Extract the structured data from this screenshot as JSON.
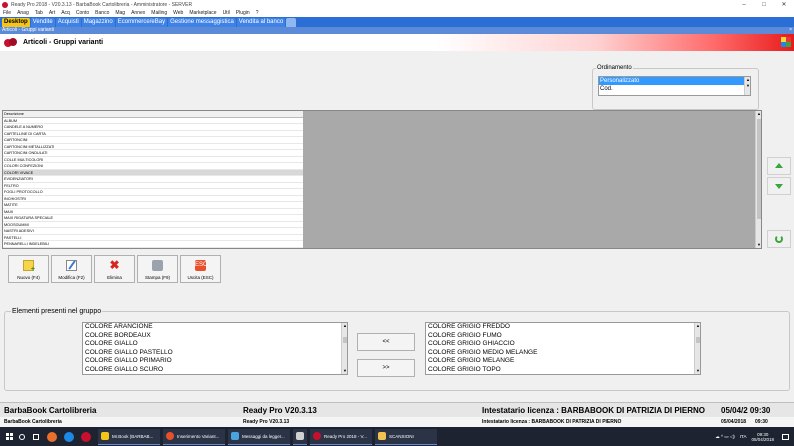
{
  "window": {
    "title": "Ready Pro 2018 - V20.3.13 - BarbaBook Cartolibreria - Amministratore - SERVER",
    "controls": {
      "minimize": "–",
      "maximize": "□",
      "close": "✕"
    }
  },
  "menu": [
    "File",
    "Anag",
    "Tab",
    "Art",
    "Acq",
    "Conto",
    "Banco",
    "Mag",
    "Annex",
    "Mailing",
    "Web",
    "Marketplace",
    "Util",
    "Plugin",
    "?"
  ],
  "tabs": [
    {
      "label": "Desktop",
      "active": true
    },
    {
      "label": "Vendite"
    },
    {
      "label": "Acquisti"
    },
    {
      "label": "Magazzino"
    },
    {
      "label": "Ecommerce/eBay"
    },
    {
      "label": "Gestione messaggistica"
    },
    {
      "label": "Vendita al banco"
    }
  ],
  "doc_tab": {
    "label": "Articoli - Gruppi varianti",
    "close": "×"
  },
  "header": {
    "title": "Articoli - Gruppi varianti"
  },
  "ordering": {
    "legend": "Ordinamento",
    "options": [
      "Personalizzato",
      "Cod."
    ],
    "selected": "Personalizzato"
  },
  "groups_table": {
    "header": "Descrizione",
    "rows": [
      "ALBUM",
      "CANDELE A NUMERO",
      "CARTELLINE DI CARTA",
      "CARTONCINI",
      "CARTONCINI METALLIZZATI",
      "CARTONCINI ONDULATI",
      "COLLE MULTICOLORI",
      "COLORI CONFEZIONI",
      "COLORI VIVACE",
      "EVIDENZIATORI",
      "FELTRO",
      "FOGLI PROTOCOLLO",
      "INCHIOSTRI",
      "MATITE",
      "MAXI",
      "MAXI RIGATURA SPECIALE",
      "MOOSGUMMI",
      "NASTRI ADESIVI",
      "PASTELLI",
      "PENNARELLI INDELEBILI"
    ],
    "selected_index": 8
  },
  "toolbar": {
    "new": "Nuovo (F4)",
    "edit": "Modifica (F2)",
    "delete": "Elimina",
    "print": "Stampa (F9)",
    "exit": "Uscita (ESC)",
    "exit_icon_text": "ESC"
  },
  "members": {
    "legend": "Elementi presenti nel gruppo",
    "left_items": [
      "COLORE ARANCIONE",
      "COLORE BORDEAUX",
      "COLORE GIALLO",
      "COLORE GIALLO PASTELLO",
      "COLORE GIALLO PRIMARIO",
      "COLORE GIALLO SCURO"
    ],
    "right_items": [
      "COLORE GRIGIO FREDDO",
      "COLORE GRIGIO FUMO",
      "COLORE GRIGIO GHIACCIO",
      "COLORE GRIGIO MEDIO MELANGE",
      "COLORE GRIGIO MELANGE",
      "COLORE GRIGIO TOPO"
    ],
    "add_label": "<<",
    "remove_label": ">>"
  },
  "status": {
    "company": "BarbaBook Cartolibreria",
    "version": "Ready Pro V20.3.13",
    "license": "Intestatario licenza : BARBABOOK DI PATRIZIA DI PIERNO",
    "datetime": "05/04/2 09:30"
  },
  "info": {
    "company": "BarbaBook Cartolibreria",
    "version": "Ready Pro V20.3.13",
    "license": "Intestatario licenza : BARBABOOK DI PATRIZIA DI PIERNO",
    "date": "05/04/2018",
    "time": "09:30"
  },
  "taskbar": {
    "items": [
      {
        "label": "Mr.Book (BARBAB...",
        "color": "#f5c518"
      },
      {
        "label": "Inserimento Variant...",
        "color": "#e8502a"
      },
      {
        "label": "Messaggi da legger...",
        "color": "#4aa3df"
      },
      {
        "label": "",
        "color": "#d0d0d0"
      },
      {
        "label": "Ready Pro 2018 - V...",
        "color": "#c8102e"
      },
      {
        "label": "SCANSIONI",
        "color": "#f2c14e"
      }
    ],
    "tray_lang": "ITA",
    "tray_symbols": "☁ ^ ▭ ◁) ",
    "clock_time": "09:30",
    "clock_date": "05/04/2018"
  }
}
